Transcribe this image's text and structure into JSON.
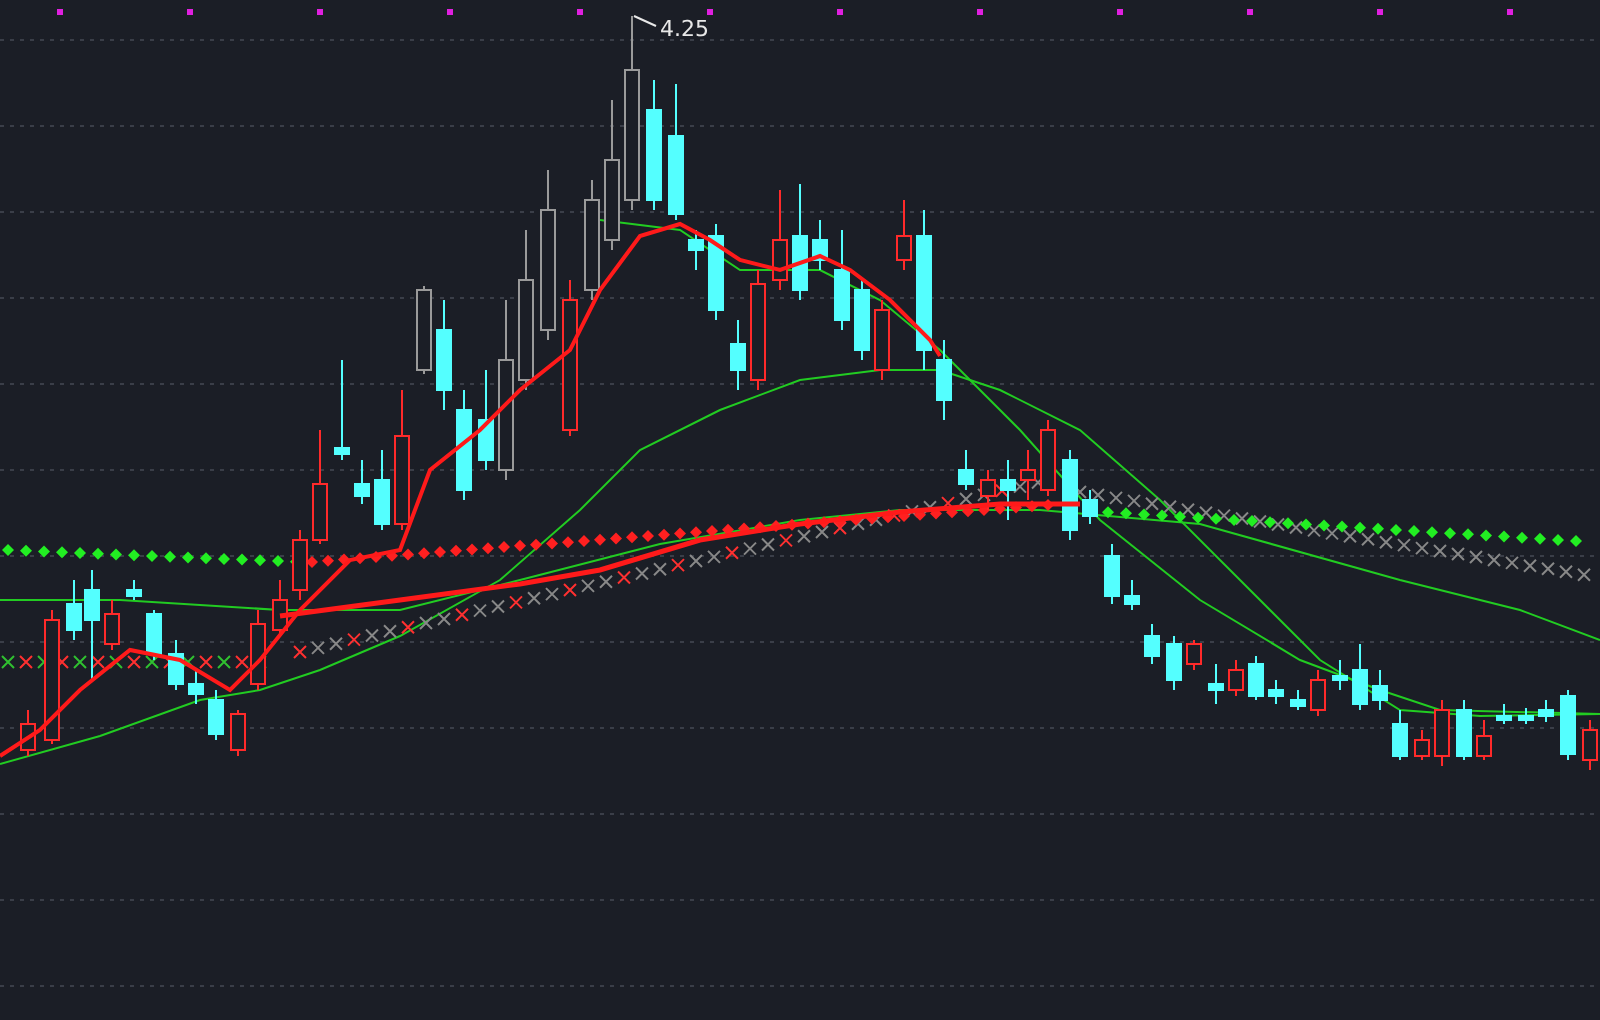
{
  "chart": {
    "peak_label": "4.25"
  }
}
